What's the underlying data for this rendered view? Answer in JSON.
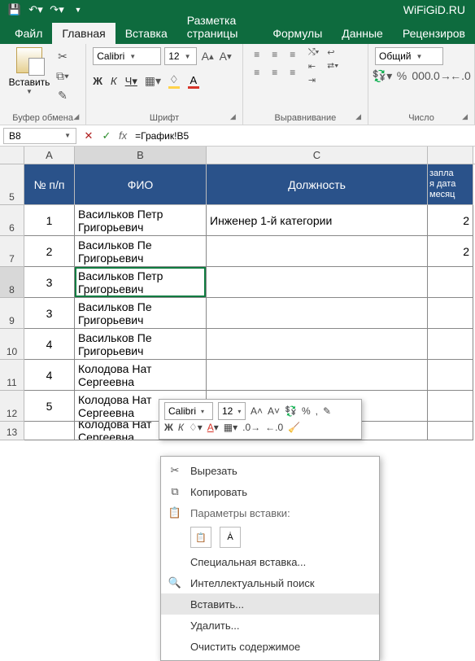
{
  "titlebar": {
    "right_text": "WiFiGiD.RU"
  },
  "tabs": {
    "file": "Файл",
    "home": "Главная",
    "insert": "Вставка",
    "layout": "Разметка страницы",
    "formulas": "Формулы",
    "data": "Данные",
    "review": "Рецензиров"
  },
  "ribbon": {
    "clipboard": {
      "paste": "Вставить",
      "group_label": "Буфер обмена"
    },
    "font": {
      "name": "Calibri",
      "size": "12",
      "bold": "Ж",
      "italic": "К",
      "underline": "Ч",
      "group_label": "Шрифт"
    },
    "alignment": {
      "wrap": "",
      "merge": "",
      "group_label": "Выравнивание"
    },
    "number": {
      "format": "Общий",
      "group_label": "Число"
    }
  },
  "formula_bar": {
    "namebox": "B8",
    "formula": "=График!B5"
  },
  "columns": {
    "A": "A",
    "B": "B",
    "C": "C"
  },
  "header_row_number": "5",
  "headers": {
    "A": "№ п/п",
    "B": "ФИО",
    "C": "Должность",
    "D": "запла\nя дата\nмесяц"
  },
  "rows": [
    {
      "rn": "6",
      "num": "1",
      "fio": "Васильков Петр Григорьевич",
      "pos": "Инженер 1-й категории",
      "d": "2"
    },
    {
      "rn": "7",
      "num": "2",
      "fio": "Васильков Пе Григорьевич",
      "pos": "",
      "d": "2"
    },
    {
      "rn": "8",
      "num": "3",
      "fio": "Васильков Петр Григорьевич",
      "pos": "",
      "d": ""
    },
    {
      "rn": "9",
      "num": "3",
      "fio": "Васильков Пе Григорьевич",
      "pos": "",
      "d": ""
    },
    {
      "rn": "10",
      "num": "4",
      "fio": "Васильков Пе Григорьевич",
      "pos": "",
      "d": ""
    },
    {
      "rn": "11",
      "num": "4",
      "fio": "Колодова Нат Сергеевна",
      "pos": "",
      "d": ""
    },
    {
      "rn": "12",
      "num": "5",
      "fio": "Колодова Нат Сергеевна",
      "pos": "",
      "d": ""
    },
    {
      "rn": "13",
      "num": "",
      "fio": "Колодова Нат Сергеевна",
      "pos": "",
      "d": ""
    }
  ],
  "minitoolbar": {
    "font": "Calibri",
    "size": "12",
    "bold": "Ж",
    "italic": "К"
  },
  "context_menu": {
    "cut": "Вырезать",
    "copy": "Копировать",
    "paste_options_header": "Параметры вставки:",
    "paste_special": "Специальная вставка...",
    "smart_lookup": "Интеллектуальный поиск",
    "insert": "Вставить...",
    "delete": "Удалить...",
    "clear": "Очистить содержимое"
  }
}
